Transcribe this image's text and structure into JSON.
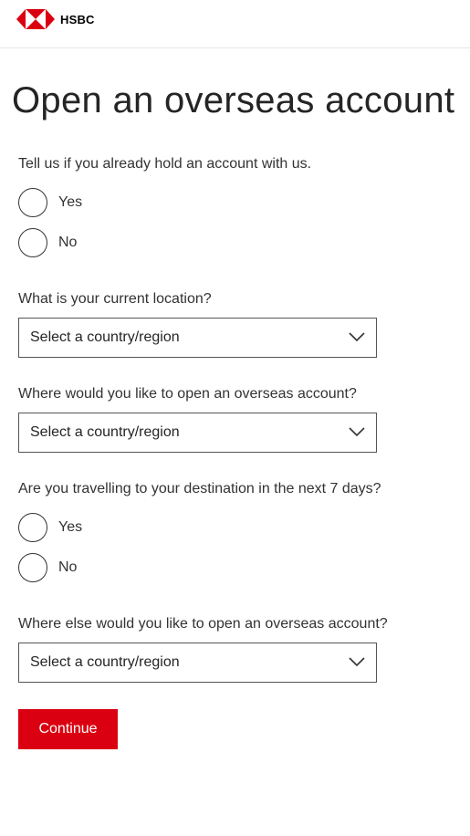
{
  "header": {
    "brand": "HSBC",
    "logo_color": "#db0011"
  },
  "page": {
    "title": "Open an overseas account"
  },
  "form": {
    "q_existing_account": {
      "label": "Tell us if you already hold an account with us.",
      "options": [
        "Yes",
        "No"
      ]
    },
    "q_current_location": {
      "label": "What is your current location?",
      "selected": "Select a country/region"
    },
    "q_open_where": {
      "label": "Where would you like to open an overseas account?",
      "selected": "Select a country/region"
    },
    "q_travelling": {
      "label": "Are you travelling to your destination in the next 7 days?",
      "options": [
        "Yes",
        "No"
      ]
    },
    "q_open_else": {
      "label": "Where else would you like to open an overseas account?",
      "selected": "Select a country/region"
    },
    "continue_label": "Continue",
    "accent_color": "#db0011"
  }
}
